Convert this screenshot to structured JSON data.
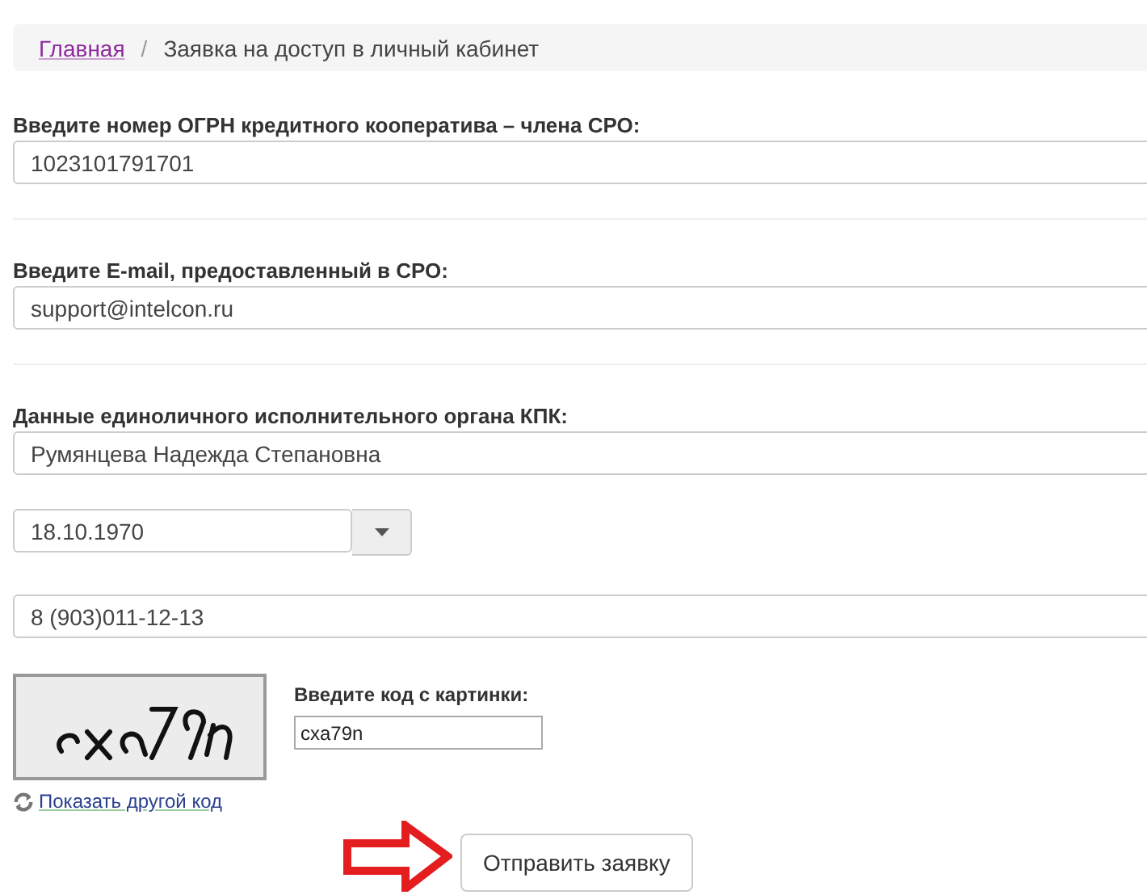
{
  "breadcrumb": {
    "home": "Главная",
    "separator": "/",
    "current": "Заявка на доступ в личный кабинет"
  },
  "ogrn": {
    "label": "Введите номер ОГРН кредитного кооператива – члена СРО:",
    "value": "1023101791701"
  },
  "email": {
    "label": "Введите E-mail, предоставленный в СРО:",
    "value": "support@intelcon.ru"
  },
  "head": {
    "label": "Данные единоличного исполнительного органа КПК:",
    "name": "Румянцева Надежда Степановна",
    "birth_date": "18.10.1970",
    "phone": "8 (903)011-12-13"
  },
  "captcha": {
    "label": "Введите код с картинки:",
    "value": "cxa79n",
    "refresh_link": "Показать другой код"
  },
  "submit": "Отправить заявку"
}
